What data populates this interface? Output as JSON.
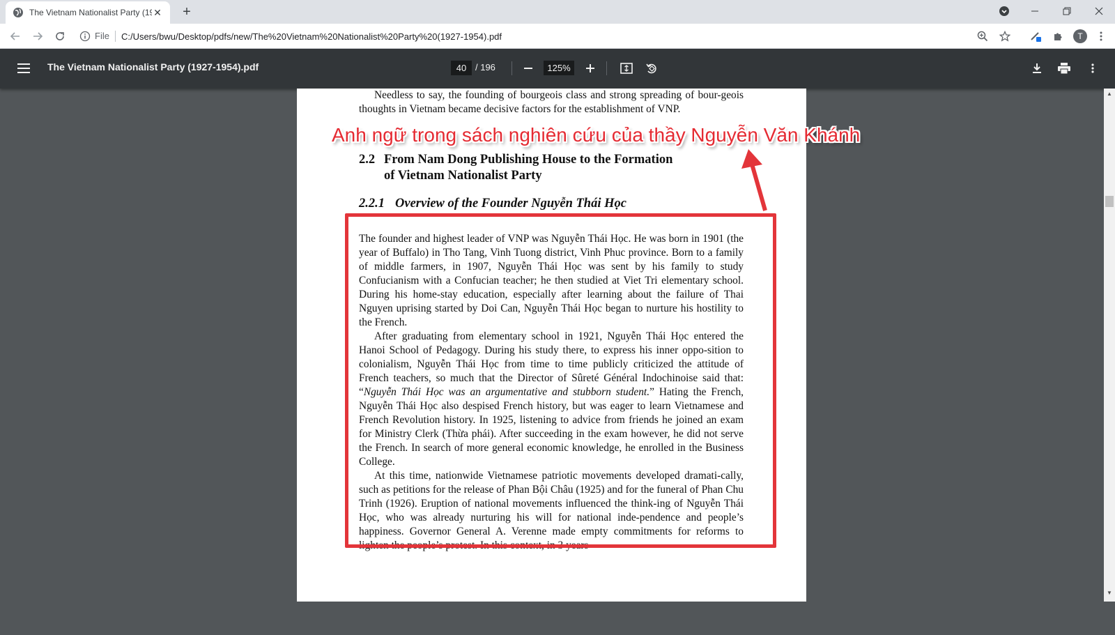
{
  "browser": {
    "tab_title": "The Vietnam Nationalist Party (19",
    "new_tab": "+",
    "address": {
      "scheme_label": "File",
      "url": "C:/Users/bwu/Desktop/pdfs/new/The%20Vietnam%20Nationalist%20Party%20(1927-1954).pdf"
    },
    "profile_initial": "T"
  },
  "pdf_viewer": {
    "title": "The Vietnam Nationalist Party (1927-1954).pdf",
    "current_page": "40",
    "total_pages": "/ 196",
    "zoom": "125%"
  },
  "document": {
    "intro": "Needless to say, the founding of bourgeois class and strong spreading of bour-geois thoughts in Vietnam became decisive factors for the establishment of VNP.",
    "section_number": "2.2",
    "section_title_line1": "From Nam Dong Publishing House to the Formation",
    "section_title_line2": "of Vietnam Nationalist Party",
    "subsection_number": "2.2.1",
    "subsection_title": "Overview of the Founder Nguyễn Thái Học",
    "paragraph1": "The founder and highest leader of VNP was Nguyễn Thái Học. He was born in 1901 (the year of Buffalo) in Tho Tang, Vinh Tuong district, Vinh Phuc province. Born to a family of middle farmers, in 1907, Nguyễn Thái Học was sent by his family to study Confucianism with a Confucian teacher; he then studied at Viet Tri elementary school. During his home-stay education, especially after learning about the failure of Thai Nguyen uprising started by Doi Can, Nguyễn Thái Học began to nurture his hostility to the French.",
    "paragraph2_before_quote": "After graduating from elementary school in 1921, Nguyễn Thái Học entered the Hanoi School of Pedagogy. During his study there, to express his inner oppo-sition to colonialism, Nguyễn Thái Học from time to time publicly criticized the attitude of French teachers, so much that the Director of Sûreté Général Indochinoise said that: “",
    "paragraph2_quote": "Nguyễn Thái Học was an argumentative and stubborn student.",
    "paragraph2_after_quote": "” Hating the French, Nguyễn Thái Học also despised French history, but was eager to learn Vietnamese and French Revolution history. In 1925, listening to advice from friends he joined an exam for Ministry Clerk (Thừa phái). After succeeding in the exam however, he did not serve the French. In search of more general economic knowledge, he enrolled in the Business College.",
    "paragraph3": "At this time, nationwide Vietnamese patriotic movements developed dramati-cally, such as petitions for the release of Phan Bội Châu (1925) and for the funeral of Phan Chu Trinh (1926). Eruption of national movements influenced the think-ing of Nguyễn Thái Học, who was already nurturing his will for national inde-pendence and people’s happiness. Governor General A. Verenne made empty commitments for reforms to lighten the people’s protest. In this context, in 3 years"
  },
  "annotation": {
    "caption": "Anh ngữ trong sách nghiên cứu của thầy Nguyễn Văn Khánh",
    "color": "#e52b33"
  }
}
